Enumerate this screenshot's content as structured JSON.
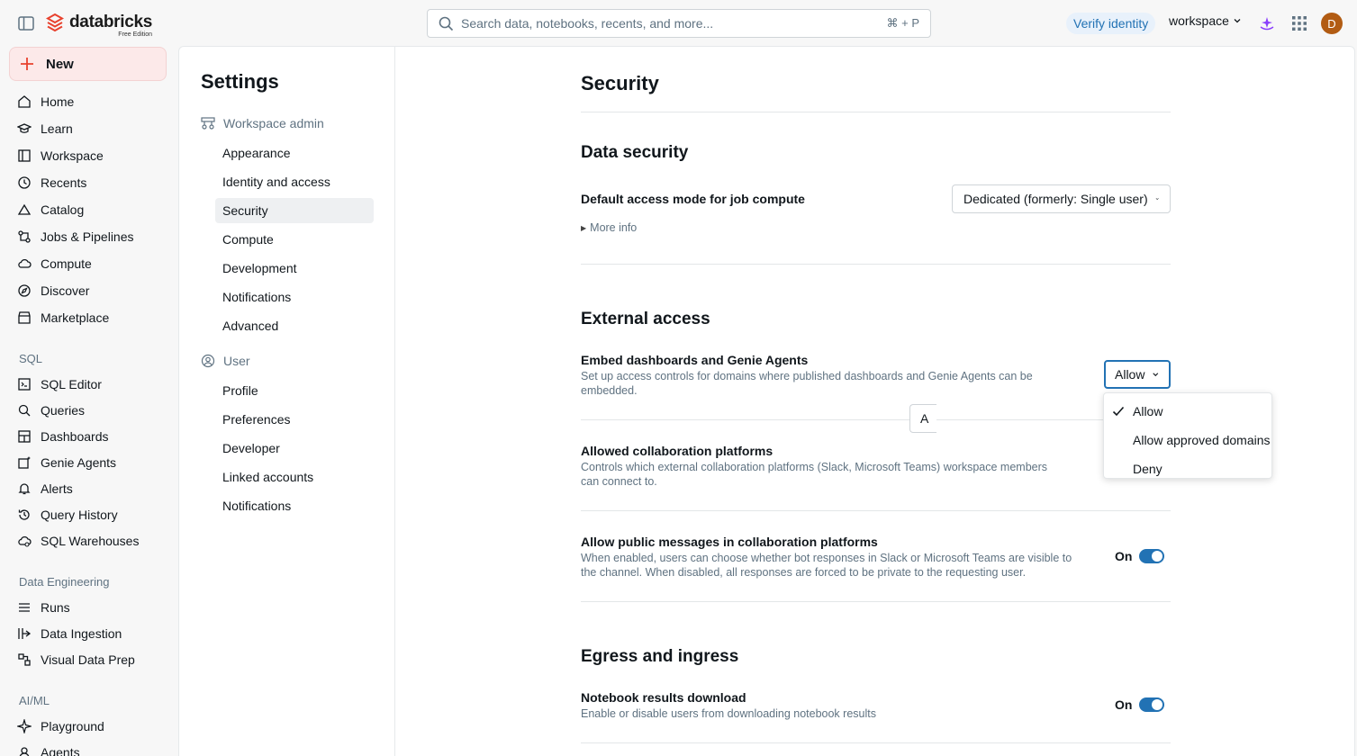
{
  "topbar": {
    "brand": "databricks",
    "brand_sub": "Free Edition",
    "search_placeholder": "Search data, notebooks, recents, and more...",
    "search_shortcut": "⌘ + P",
    "verify_label": "Verify identity",
    "workspace_label": "workspace",
    "avatar_initial": "D"
  },
  "leftnav": {
    "new_label": "New",
    "items": [
      "Home",
      "Learn",
      "Workspace",
      "Recents",
      "Catalog",
      "Jobs & Pipelines",
      "Compute",
      "Discover",
      "Marketplace"
    ],
    "sql_section": "SQL",
    "sql_items": [
      "SQL Editor",
      "Queries",
      "Dashboards",
      "Genie Agents",
      "Alerts",
      "Query History",
      "SQL Warehouses"
    ],
    "de_section": "Data Engineering",
    "de_items": [
      "Runs",
      "Data Ingestion",
      "Visual Data Prep"
    ],
    "ml_section": "AI/ML",
    "ml_items": [
      "Playground",
      "Agents"
    ]
  },
  "settings": {
    "title": "Settings",
    "admin_group": "Workspace admin",
    "admin_items": [
      "Appearance",
      "Identity and access",
      "Security",
      "Compute",
      "Development",
      "Notifications",
      "Advanced"
    ],
    "user_group": "User",
    "user_items": [
      "Profile",
      "Preferences",
      "Developer",
      "Linked accounts",
      "Notifications"
    ]
  },
  "page": {
    "title": "Security",
    "data_security": {
      "heading": "Data security",
      "default_access_label": "Default access mode for job compute",
      "default_access_value": "Dedicated (formerly: Single user)",
      "more_info": "More info"
    },
    "external_access": {
      "heading": "External access",
      "embed_label": "Embed dashboards and Genie Agents",
      "embed_desc": "Set up access controls for domains where published dashboards and Genie Agents can be embedded.",
      "embed_value": "Allow",
      "collab_label": "Allowed collaboration platforms",
      "collab_desc": "Controls which external collaboration platforms (Slack, Microsoft Teams) workspace members can connect to.",
      "collab_value_partial": "A",
      "public_label": "Allow public messages in collaboration platforms",
      "public_desc": "When enabled, users can choose whether bot responses in Slack or Microsoft Teams are visible to the channel. When disabled, all responses are forced to be private to the requesting user.",
      "public_toggle": "On"
    },
    "egress": {
      "heading": "Egress and ingress",
      "download_label": "Notebook results download",
      "download_desc": "Enable or disable users from downloading notebook results",
      "download_toggle": "On"
    }
  },
  "dropdown": {
    "options": [
      "Allow",
      "Allow approved domains",
      "Deny"
    ],
    "selected": "Allow"
  },
  "colors": {
    "accent": "#2272b4",
    "brand": "#e8412d",
    "avatar": "#b25c13"
  }
}
